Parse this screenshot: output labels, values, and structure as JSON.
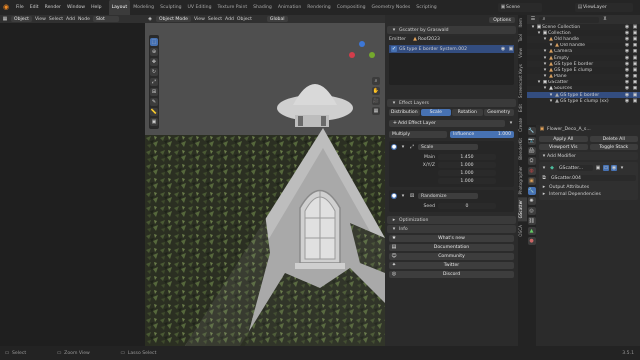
{
  "topbar": {
    "menus": [
      "File",
      "Edit",
      "Render",
      "Window",
      "Help"
    ],
    "workspaces": [
      "Layout",
      "Modeling",
      "Sculpting",
      "UV Editing",
      "Texture Paint",
      "Shading",
      "Animation",
      "Rendering",
      "Compositing",
      "Geometry Nodes",
      "Scripting"
    ],
    "scene": "Scene",
    "view_layer": "ViewLayer"
  },
  "node_header": {
    "mode": "Object",
    "items": [
      "View",
      "Select",
      "Add",
      "Node"
    ],
    "slot": "Slot"
  },
  "viewport_header": {
    "mode": "Object Mode",
    "items": [
      "View",
      "Select",
      "Add",
      "Object"
    ],
    "orientation": "Global",
    "options": "Options"
  },
  "gscatter": {
    "title": "Gscatter by Graswald",
    "emitter_label": "Emitter",
    "emitter_value": "Roof2023",
    "system_name": "GS type E border System.002",
    "effect_layers_title": "Effect Layers",
    "effect_tabs": [
      "Distribution",
      "Scale",
      "Rotation",
      "Geometry"
    ],
    "active_tab": "Scale",
    "add_effect": "Add Effect Layer",
    "blend_mode": "Multiply",
    "influence_label": "Influence",
    "influence_value": "1.000",
    "scale_layer": "Scale",
    "main_label": "Main",
    "main_value": "1.450",
    "xyz_label": "X/Y/Z",
    "xyz_values": [
      "1.000",
      "1.000",
      "1.000"
    ],
    "randomize_layer": "Randomize",
    "seed_label": "Seed",
    "seed_value": "0",
    "optimization": "Optimization",
    "info": "Info",
    "links": [
      "What's new",
      "Documentation",
      "Community",
      "Twitter",
      "Discord"
    ],
    "side_tabs": [
      "Item",
      "Tool",
      "View",
      "Screencast Keys",
      "Edit",
      "Create",
      "BlenderKit",
      "Photographer",
      "GScatter",
      "OSCA"
    ]
  },
  "outliner": {
    "rows": [
      {
        "depth": 0,
        "label": "Scene Collection",
        "color": "#d8d8d8"
      },
      {
        "depth": 1,
        "label": "Collection",
        "color": "#d8d8d8"
      },
      {
        "depth": 2,
        "label": "Old handle",
        "color": "#d8a060"
      },
      {
        "depth": 3,
        "label": "Old handle",
        "color": "#d8a060"
      },
      {
        "depth": 2,
        "label": "Camera",
        "color": "#d8a060"
      },
      {
        "depth": 2,
        "label": "Empty",
        "color": "#d8a060"
      },
      {
        "depth": 2,
        "label": "GS type E border",
        "color": "#d8a060"
      },
      {
        "depth": 2,
        "label": "GS type E clump",
        "color": "#d8a060"
      },
      {
        "depth": 2,
        "label": "Plane",
        "color": "#d8a060"
      },
      {
        "depth": 1,
        "label": "GScatter",
        "color": "#d8d8d8"
      },
      {
        "depth": 2,
        "label": "Sources",
        "color": "#d8d8d8"
      },
      {
        "depth": 3,
        "label": "GS type E border",
        "color": "#aaaaaa"
      },
      {
        "depth": 3,
        "label": "GS type E clump (xx)",
        "color": "#aaaaaa"
      }
    ]
  },
  "properties": {
    "object_name": "Flower_Deco_A_s...",
    "apply_all": "Apply All",
    "delete_all": "Delete All",
    "viewport_vis": "Viewport Vis",
    "toggle_stack": "Toggle Stack",
    "add_modifier": "Add Modifier",
    "modifier_name": "GScatter...",
    "node_group": "GScatter.004",
    "output_attributes": "Output Attributes",
    "internal_dependencies": "Internal Dependencies"
  },
  "statusbar": {
    "left": "Select",
    "mid": "Zoom View",
    "right": "Lasso Select",
    "version": "3.5.1"
  },
  "colors": {
    "accent": "#4772b3",
    "header": "#303030",
    "panel": "#2b2b2b",
    "sky": "#555555"
  }
}
